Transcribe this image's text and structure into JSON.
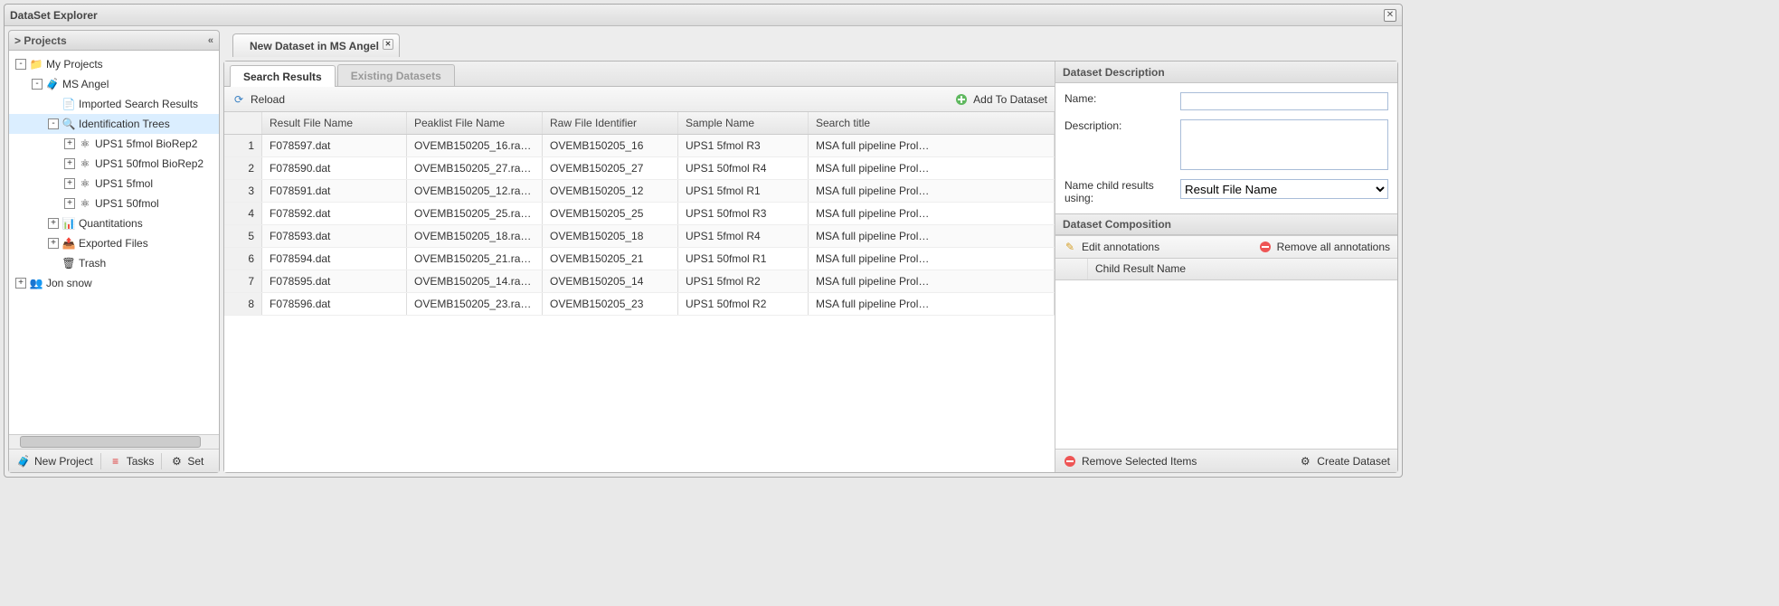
{
  "window": {
    "title": "DataSet Explorer"
  },
  "projects": {
    "header": "> Projects",
    "toolbar": {
      "newProject": "New Project",
      "tasks": "Tasks",
      "settings": "Set"
    },
    "tree": [
      {
        "depth": 0,
        "toggle": "-",
        "icon": "folder",
        "label": "My Projects"
      },
      {
        "depth": 1,
        "toggle": "-",
        "icon": "case",
        "label": "MS Angel"
      },
      {
        "depth": 2,
        "toggle": "",
        "icon": "doc",
        "label": "Imported Search Results"
      },
      {
        "depth": 2,
        "toggle": "-",
        "icon": "lens",
        "label": "Identification Trees",
        "selected": true
      },
      {
        "depth": 3,
        "toggle": "+",
        "icon": "mol",
        "label": "UPS1 5fmol BioRep2"
      },
      {
        "depth": 3,
        "toggle": "+",
        "icon": "mol",
        "label": "UPS1 50fmol BioRep2"
      },
      {
        "depth": 3,
        "toggle": "+",
        "icon": "mol",
        "label": "UPS1 5fmol"
      },
      {
        "depth": 3,
        "toggle": "+",
        "icon": "mol",
        "label": "UPS1 50fmol"
      },
      {
        "depth": 2,
        "toggle": "+",
        "icon": "bars",
        "label": "Quantitations"
      },
      {
        "depth": 2,
        "toggle": "+",
        "icon": "export",
        "label": "Exported Files"
      },
      {
        "depth": 2,
        "toggle": "",
        "icon": "trash",
        "label": "Trash"
      },
      {
        "depth": 0,
        "toggle": "+",
        "icon": "users",
        "label": "Jon snow"
      }
    ]
  },
  "tab": {
    "title": "New Dataset in MS Angel"
  },
  "innerTabs": {
    "active": "Search Results",
    "inactive": "Existing Datasets"
  },
  "actions": {
    "reload": "Reload",
    "add": "Add To Dataset"
  },
  "grid": {
    "headers": [
      "",
      "Result File Name",
      "Peaklist File Name",
      "Raw File Identifier",
      "Sample Name",
      "Search title"
    ],
    "rows": [
      {
        "n": "1",
        "rf": "F078597.dat",
        "pk": "OVEMB150205_16.ra…",
        "raw": "OVEMB150205_16",
        "sample": "UPS1 5fmol R3",
        "title": "MSA full pipeline Prol…"
      },
      {
        "n": "2",
        "rf": "F078590.dat",
        "pk": "OVEMB150205_27.ra…",
        "raw": "OVEMB150205_27",
        "sample": "UPS1 50fmol R4",
        "title": "MSA full pipeline Prol…"
      },
      {
        "n": "3",
        "rf": "F078591.dat",
        "pk": "OVEMB150205_12.ra…",
        "raw": "OVEMB150205_12",
        "sample": "UPS1 5fmol R1",
        "title": "MSA full pipeline Prol…"
      },
      {
        "n": "4",
        "rf": "F078592.dat",
        "pk": "OVEMB150205_25.ra…",
        "raw": "OVEMB150205_25",
        "sample": "UPS1 50fmol R3",
        "title": "MSA full pipeline Prol…"
      },
      {
        "n": "5",
        "rf": "F078593.dat",
        "pk": "OVEMB150205_18.ra…",
        "raw": "OVEMB150205_18",
        "sample": "UPS1 5fmol R4",
        "title": "MSA full pipeline Prol…"
      },
      {
        "n": "6",
        "rf": "F078594.dat",
        "pk": "OVEMB150205_21.ra…",
        "raw": "OVEMB150205_21",
        "sample": "UPS1 50fmol R1",
        "title": "MSA full pipeline Prol…"
      },
      {
        "n": "7",
        "rf": "F078595.dat",
        "pk": "OVEMB150205_14.ra…",
        "raw": "OVEMB150205_14",
        "sample": "UPS1 5fmol R2",
        "title": "MSA full pipeline Prol…"
      },
      {
        "n": "8",
        "rf": "F078596.dat",
        "pk": "OVEMB150205_23.ra…",
        "raw": "OVEMB150205_23",
        "sample": "UPS1 50fmol R2",
        "title": "MSA full pipeline Prol…"
      }
    ]
  },
  "descSection": {
    "header": "Dataset Description",
    "nameLabel": "Name:",
    "nameValue": "",
    "descLabel": "Description:",
    "descValue": "",
    "childLabel": "Name child results using:",
    "childValue": "Result File Name"
  },
  "compSection": {
    "header": "Dataset Composition",
    "edit": "Edit annotations",
    "removeAll": "Remove all annotations",
    "col": "Child Result Name"
  },
  "footer": {
    "removeSelected": "Remove Selected Items",
    "create": "Create Dataset"
  }
}
